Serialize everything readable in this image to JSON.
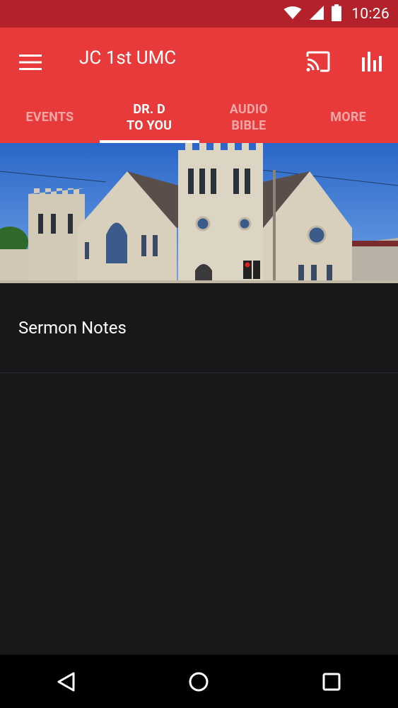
{
  "status_bar": {
    "time": "10:26",
    "icons": [
      "wifi-icon",
      "cellular-signal-icon",
      "battery-icon"
    ]
  },
  "app_bar": {
    "title": "JC 1st UMC",
    "background_color": "#e83a3a",
    "actions": [
      "cast-icon",
      "chart-icon"
    ],
    "menu_icon": "hamburger-menu-icon"
  },
  "tabs": [
    {
      "label_line1": "EVENTS",
      "label_line2": "",
      "active": false
    },
    {
      "label_line1": "DR. D",
      "label_line2": "TO YOU",
      "active": true
    },
    {
      "label_line1": "AUDIO",
      "label_line2": "BIBLE",
      "active": false
    },
    {
      "label_line1": "MORE",
      "label_line2": "",
      "active": false
    }
  ],
  "hero": {
    "description": "church-photo"
  },
  "list": [
    {
      "label": "Sermon Notes"
    }
  ],
  "nav_bar": {
    "buttons": [
      "back-icon",
      "home-icon",
      "recents-icon"
    ]
  }
}
